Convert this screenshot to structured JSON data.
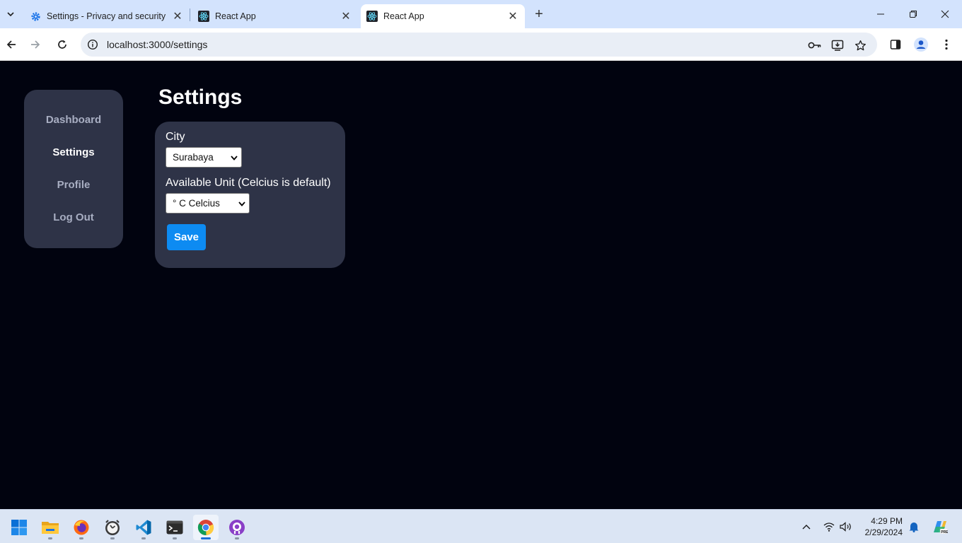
{
  "browser": {
    "tabs": [
      {
        "title": "Settings - Privacy and security",
        "icon": "gear-icon"
      },
      {
        "title": "React App",
        "icon": "react-icon"
      },
      {
        "title": "React App",
        "icon": "react-icon",
        "active": true
      }
    ],
    "url": "localhost:3000/settings"
  },
  "sidebar": {
    "items": [
      {
        "label": "Dashboard"
      },
      {
        "label": "Settings",
        "active": true
      },
      {
        "label": "Profile"
      },
      {
        "label": "Log Out"
      }
    ]
  },
  "settings": {
    "title": "Settings",
    "city_label": "City",
    "city_value": "Surabaya",
    "unit_label": "Available Unit (Celcius is default)",
    "unit_value": "° C Celcius",
    "save_label": "Save"
  },
  "taskbar": {
    "apps": [
      "start-icon",
      "file-explorer-icon",
      "firefox-icon",
      "clock-app-icon",
      "vscode-icon",
      "terminal-icon",
      "chrome-icon",
      "github-desktop-icon"
    ],
    "active_app": "chrome-icon",
    "time": "4:29 PM",
    "date": "2/29/2024"
  },
  "colors": {
    "page_bg": "#01030f",
    "panel_bg": "#2e3347",
    "accent": "#0d8bf2",
    "tabstrip": "#d3e3fd"
  }
}
